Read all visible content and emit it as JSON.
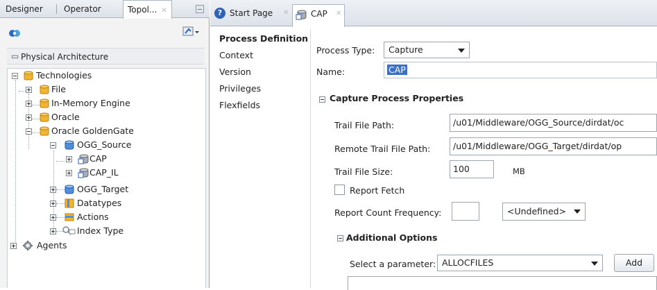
{
  "left_tabs": [
    {
      "label": "Designer"
    },
    {
      "label": "Operator"
    },
    {
      "label": "Topol..."
    }
  ],
  "physical_architecture": {
    "label": "Physical Architecture"
  },
  "tree": {
    "technologies": "Technologies",
    "file": "File",
    "in_memory_engine": "In-Memory Engine",
    "oracle": "Oracle",
    "oracle_goldengate": "Oracle GoldenGate",
    "ogg_source": "OGG_Source",
    "cap": "CAP",
    "cap_il": "CAP_IL",
    "ogg_target": "OGG_Target",
    "datatypes": "Datatypes",
    "actions": "Actions",
    "index_type": "Index Type",
    "agents": "Agents"
  },
  "editor_tabs": [
    {
      "label": "Start Page"
    },
    {
      "label": "CAP"
    }
  ],
  "editor_nav": [
    "Process Definition",
    "Context",
    "Version",
    "Privileges",
    "Flexfields"
  ],
  "form": {
    "process_type_label": "Process Type:",
    "process_type_value": "Capture",
    "name_label": "Name:",
    "name_value": "CAP",
    "capture_section": "Capture Process Properties",
    "trail_file_path_label": "Trail File Path:",
    "trail_file_path_value": "/u01/Middleware/OGG_Source/dirdat/oc",
    "remote_trail_label": "Remote Trail File Path:",
    "remote_trail_value": "/u01/Middleware/OGG_Target/dirdat/op",
    "trail_file_size_label": "Trail File Size:",
    "trail_file_size_value": "100",
    "trail_file_size_unit": "MB",
    "report_fetch_label": "Report Fetch",
    "report_count_label": "Report Count Frequency:",
    "report_count_value": "",
    "report_count_unit": "<Undefined>",
    "additional_section": "Additional Options",
    "select_param_label": "Select a parameter:",
    "select_param_value": "ALLOCFILES",
    "add_label": "Add"
  },
  "colors": {
    "selection": "#3d6fc2",
    "folder": "#f2b431",
    "tab_bar": "#dde2ea"
  }
}
